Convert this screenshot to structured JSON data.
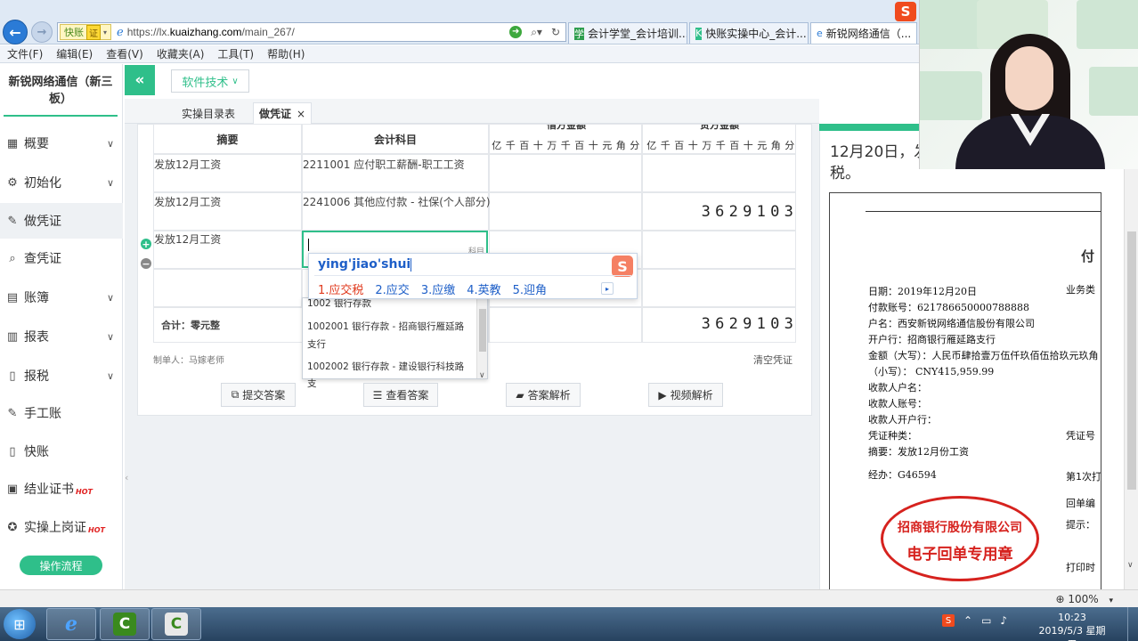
{
  "browser": {
    "address_badge": "快账",
    "address_badge_tag": "证",
    "url_prefix": "https://lx.",
    "url_domain": "kuaizhang.com",
    "url_path": "/main_267/",
    "tabs": [
      {
        "label": "会计学堂_会计培训...",
        "icon": "学"
      },
      {
        "label": "快账实操中心_会计...",
        "icon": "K"
      },
      {
        "label": "新锐网络通信（...",
        "icon": "e"
      }
    ],
    "menu": [
      "文件(F)",
      "编辑(E)",
      "查看(V)",
      "收藏夹(A)",
      "工具(T)",
      "帮助(H)"
    ]
  },
  "sidebar": {
    "company": "新锐网络通信（新三板）",
    "items": [
      {
        "label": "概要",
        "icon": "grid-icon",
        "glyph": "▦",
        "chevron": true
      },
      {
        "label": "初始化",
        "icon": "gear-icon",
        "glyph": "⚙",
        "chevron": true
      },
      {
        "label": "做凭证",
        "icon": "pen-icon",
        "glyph": "✎",
        "chevron": false,
        "active": true
      },
      {
        "label": "查凭证",
        "icon": "search-icon",
        "glyph": "⌕",
        "chevron": false
      },
      {
        "label": "账簿",
        "icon": "book-icon",
        "glyph": "▤",
        "chevron": true
      },
      {
        "label": "报表",
        "icon": "report-icon",
        "glyph": "▥",
        "chevron": true
      },
      {
        "label": "报税",
        "icon": "file-icon",
        "glyph": "▯",
        "chevron": true
      },
      {
        "label": "手工账",
        "icon": "pen-icon",
        "glyph": "✎",
        "chevron": false
      },
      {
        "label": "快账",
        "icon": "file-icon",
        "glyph": "▯",
        "chevron": false
      },
      {
        "label": "结业证书",
        "icon": "certificate-icon",
        "glyph": "▣",
        "chevron": false,
        "hot": "HOT"
      },
      {
        "label": "实操上岗证",
        "icon": "badge-icon",
        "glyph": "✪",
        "chevron": false,
        "hot": "HOT"
      }
    ],
    "flow_button": "操作流程"
  },
  "toolbar": {
    "collapse_glyph": "«",
    "software_button": "软件技术"
  },
  "page_tabs": {
    "tab1": "实操目录表",
    "tab2": "做凭证",
    "close_glyph": "×"
  },
  "voucher": {
    "col_summary": "摘要",
    "col_subject": "会计科目",
    "col_debit": "借方金额",
    "col_credit": "贷方金额",
    "digits": [
      "亿",
      "千",
      "百",
      "十",
      "万",
      "千",
      "百",
      "十",
      "元",
      "角",
      "分"
    ],
    "rows": [
      {
        "summary": "发放12月工资",
        "subject": "2211001 应付职工薪酬-职工工资"
      },
      {
        "summary": "发放12月工资",
        "subject": "2241006 其他应付款 - 社保(个人部分)"
      },
      {
        "summary": "发放12月工资",
        "subject": ""
      }
    ],
    "row2_credit": [
      "3",
      "6",
      "2",
      "9",
      "1",
      "0",
      "3"
    ],
    "input_hint": "科目",
    "total_label": "合计：零元整",
    "total_credit": [
      "3",
      "6",
      "2",
      "9",
      "1",
      "0",
      "3"
    ],
    "maker": "制单人：马嫁老师",
    "clear": "清空凭证"
  },
  "dropdown": {
    "items": [
      "1002 银行存款",
      "1002001 银行存款 - 招商银行雁延路支行",
      "1002002 银行存款 - 建设银行科技路支"
    ]
  },
  "ime": {
    "pinyin": "ying'jiao'shui",
    "candidates": [
      "1.应交税",
      "2.应交",
      "3.应缴",
      "4.英教",
      "5.迎角"
    ],
    "logo": "S",
    "next_glyph": "▸"
  },
  "actions": {
    "submit": "提交答案",
    "view": "查看答案",
    "analysis": "答案解析",
    "video": "视频解析"
  },
  "right_panel": {
    "title": "12月20日，发放12月工资，代扣社保和个税。",
    "doc_title": "付",
    "lines": [
      "日期：2019年12月20日",
      "付款账号：621786650000788888",
      "户名：西安新锐网络通信股份有限公司",
      "开户行：招商银行雁延路支行",
      "金额（大写）：人民币肆拾壹万伍仟玖佰伍拾玖元玖角",
      "（小写）：  CNY415,959.99",
      "收款人户名：",
      "收款人账号：",
      "收款人开户行：",
      "凭证种类：",
      "摘要：发放12月份工资",
      "经办：G46594"
    ],
    "right_labels": [
      "业务类",
      "凭证号",
      "第1次打",
      "回单编",
      "提示：",
      "打印时"
    ],
    "stamp_line1": "招商银行股份有限公司",
    "stamp_line2": "电子回单专用章"
  },
  "status": {
    "zoom": "100%"
  },
  "taskbar": {
    "time": "10:23",
    "date": "2019/5/3 星期五"
  },
  "colors": {
    "accent": "#2fbf8a",
    "stamp": "#d6221e",
    "ime_blue": "#1e5fc8"
  }
}
